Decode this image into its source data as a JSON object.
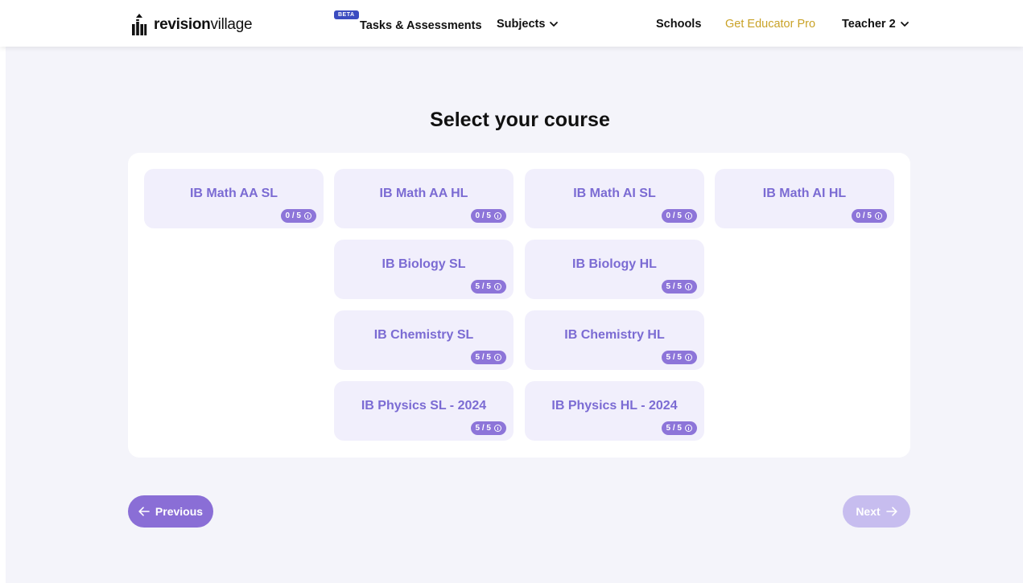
{
  "header": {
    "logo_bold": "revision",
    "logo_regular": "village",
    "beta_label": "BETA",
    "nav": {
      "tasks": "Tasks & Assessments",
      "subjects": "Subjects",
      "schools": "Schools",
      "educator": "Get Educator Pro",
      "user": "Teacher 2"
    }
  },
  "page": {
    "title": "Select your course"
  },
  "courses": [
    {
      "label": "IB Math AA SL",
      "progress": "0 / 5"
    },
    {
      "label": "IB Math AA HL",
      "progress": "0 / 5"
    },
    {
      "label": "IB Math AI SL",
      "progress": "0 / 5"
    },
    {
      "label": "IB Math AI HL",
      "progress": "0 / 5"
    },
    {
      "label": "IB Biology SL",
      "progress": "5 / 5"
    },
    {
      "label": "IB Biology HL",
      "progress": "5 / 5"
    },
    {
      "label": "IB Chemistry SL",
      "progress": "5 / 5"
    },
    {
      "label": "IB Chemistry HL",
      "progress": "5 / 5"
    },
    {
      "label": "IB Physics SL - 2024",
      "progress": "5 / 5"
    },
    {
      "label": "IB Physics HL - 2024",
      "progress": "5 / 5"
    }
  ],
  "buttons": {
    "previous": "Previous",
    "next": "Next"
  },
  "colors": {
    "accent": "#8a6ed6",
    "card_bg": "#f1effc",
    "card_text": "#7b6bd3",
    "educator": "#c9a227",
    "beta": "#3b4cc0"
  },
  "icons": [
    "logo-icon",
    "chevron-down-icon",
    "info-icon",
    "arrow-left-icon",
    "arrow-right-icon"
  ]
}
